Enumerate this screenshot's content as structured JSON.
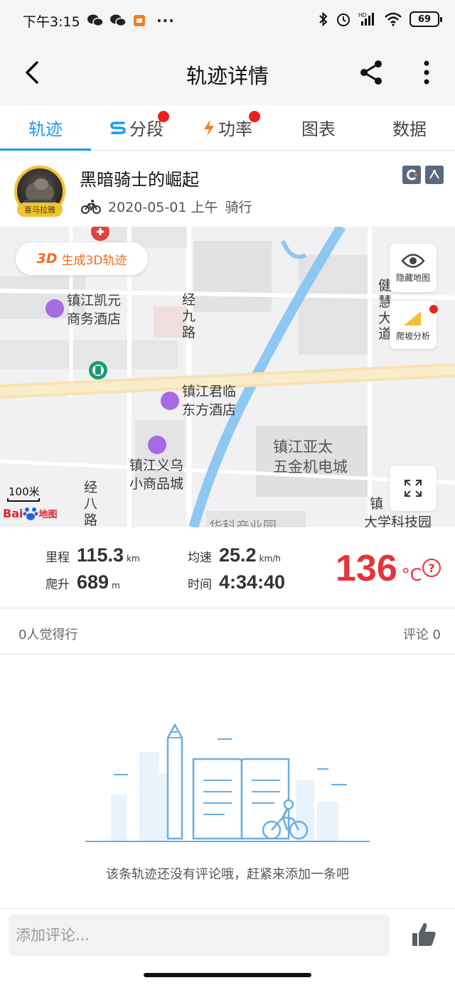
{
  "status": {
    "time": "下午3:15",
    "battery": "69",
    "hd": "HD"
  },
  "header": {
    "title": "轨迹详情"
  },
  "tabs": [
    {
      "label": "轨迹",
      "active": true,
      "dot": false
    },
    {
      "label": "分段",
      "active": false,
      "dot": true
    },
    {
      "label": "功率",
      "active": false,
      "dot": true
    },
    {
      "label": "图表",
      "active": false,
      "dot": false
    },
    {
      "label": "数据",
      "active": false,
      "dot": false
    }
  ],
  "ride": {
    "name": "黑暗骑士的崛起",
    "date": "2020-05-01 上午",
    "type": "骑行",
    "avatar_badge": "喜马拉雅"
  },
  "map": {
    "btn3d_tag": "3D",
    "btn3d_label": "生成3D轨迹",
    "hide_map": "隐藏地图",
    "slope": "爬坡分析",
    "scale": "100米",
    "baidu_prefix": "Bai",
    "baidu_suffix": "地图",
    "labels": {
      "hotel1": "镇江凯元\n商务酒店",
      "hotel2": "镇江君临\n东方酒店",
      "mall1": "镇江义乌\n小商品城",
      "mall2": "镇江亚太\n五金机电城",
      "road1": "经九路",
      "road2": "经八路",
      "road3": "健慧大道",
      "school": "大学科技园",
      "park": "华科产业园",
      "zhen": "镇"
    }
  },
  "stats": {
    "distance": {
      "label": "里程",
      "value": "115.3",
      "unit": "km"
    },
    "climb": {
      "label": "爬升",
      "value": "689",
      "unit": "m"
    },
    "speed": {
      "label": "均速",
      "value": "25.2",
      "unit": "km/h"
    },
    "time": {
      "label": "时间",
      "value": "4:34:40"
    },
    "temperature": {
      "value": "136",
      "unit": "°C"
    },
    "help": "?"
  },
  "social": {
    "likes": "0人觉得行",
    "comments": "评论 0"
  },
  "empty": {
    "text": "该条轨迹还没有评论哦，赶紧来添加一条吧"
  },
  "bottom": {
    "placeholder": "添加评论..."
  },
  "colors": {
    "accent": "#1a9bf0",
    "temperature": "#e8323a",
    "threeD": "#f26b1d",
    "road": "#f5e3b3",
    "river": "#8ec8f2"
  }
}
